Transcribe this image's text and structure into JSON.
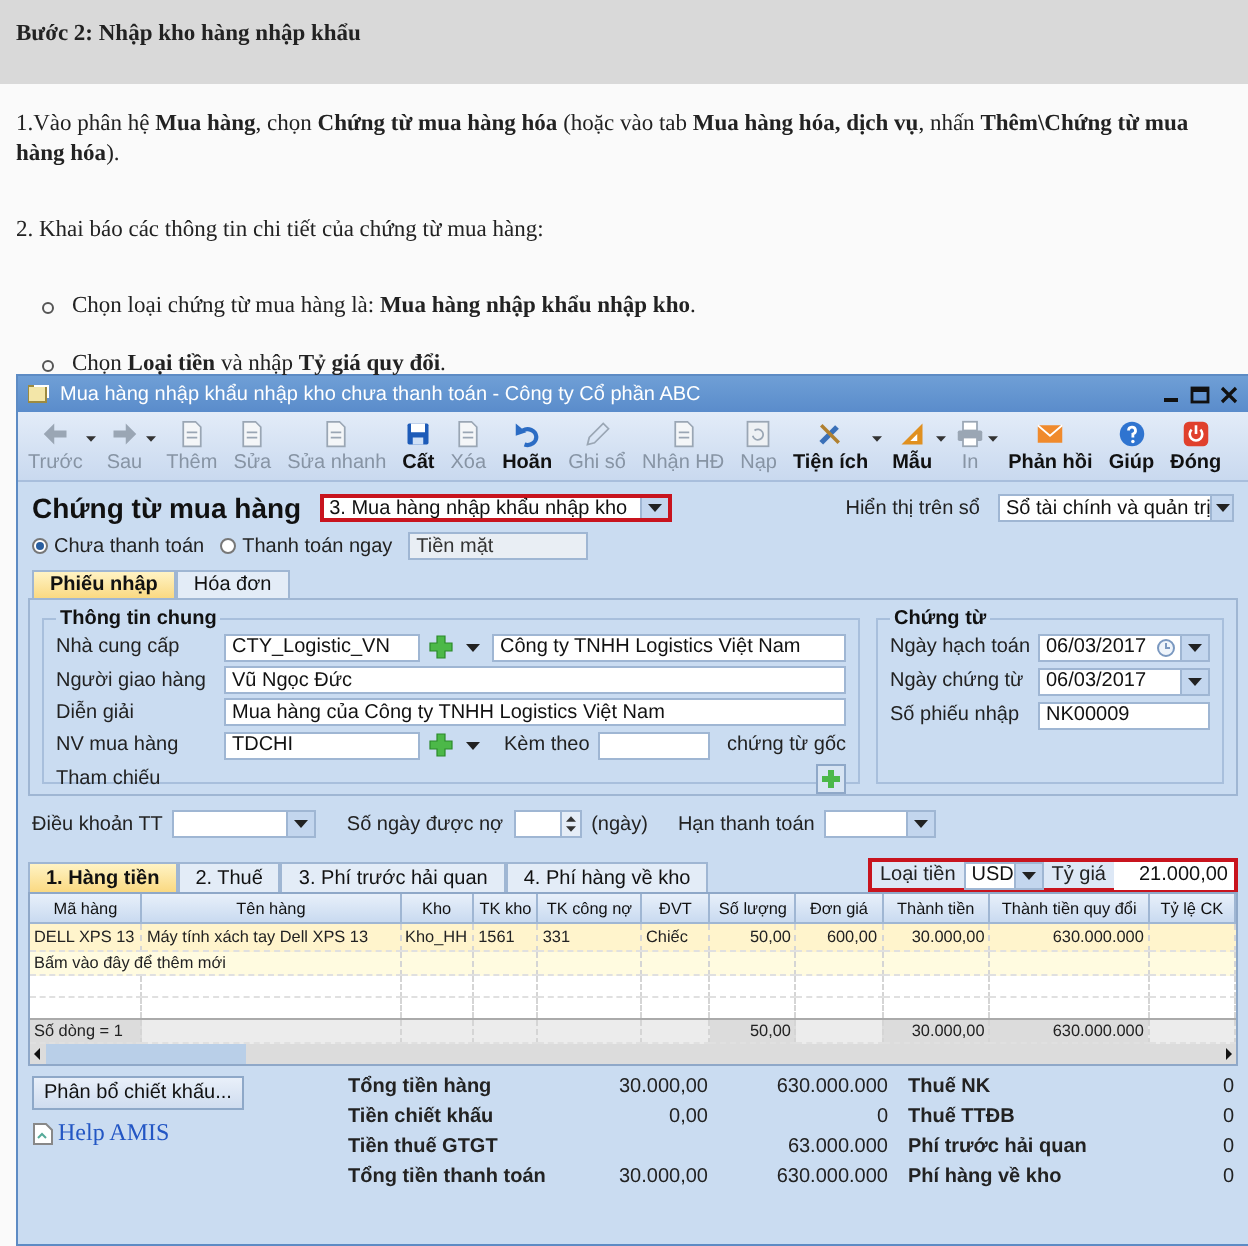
{
  "article": {
    "heading": "Bước 2: Nhập kho hàng nhập khẩu",
    "paragraphs": [
      "1.Vào phân hệ **Mua hàng**, chọn **Chứng từ mua hàng hóa** (hoặc vào tab **Mua hàng hóa, dịch vụ**, nhấn **Thêm\\Chứng từ mua hàng hóa**).",
      "2. Khai báo các thông tin chi tiết của chứng từ mua hàng:"
    ],
    "bullets": [
      "Chọn loại chứng từ mua hàng là: **Mua hàng nhập khẩu nhập kho**.",
      "Chọn **Loại tiền** và nhập **Tỷ giá quy đổi**."
    ]
  },
  "window": {
    "title": "Mua hàng nhập khẩu nhập kho chưa thanh toán - Công ty Cổ phần ABC"
  },
  "toolbar": [
    {
      "label": "Trước",
      "kind": "arrow-left",
      "disabled": true,
      "dropdown": true
    },
    {
      "label": "Sau",
      "kind": "arrow-right",
      "disabled": true,
      "dropdown": true
    },
    {
      "label": "Thêm",
      "kind": "page",
      "disabled": true,
      "dropdown": false
    },
    {
      "label": "Sửa",
      "kind": "page",
      "disabled": true,
      "dropdown": false
    },
    {
      "label": "Sửa nhanh",
      "kind": "page",
      "disabled": true,
      "dropdown": false
    },
    {
      "label": "Cất",
      "kind": "save",
      "disabled": false,
      "dropdown": false
    },
    {
      "label": "Xóa",
      "kind": "page",
      "disabled": true,
      "dropdown": false
    },
    {
      "label": "Hoãn",
      "kind": "undo",
      "disabled": false,
      "dropdown": false
    },
    {
      "label": "Ghi sổ",
      "kind": "pencil",
      "disabled": true,
      "dropdown": false
    },
    {
      "label": "Nhận HĐ",
      "kind": "page",
      "disabled": true,
      "dropdown": false
    },
    {
      "label": "Nạp",
      "kind": "refresh",
      "disabled": true,
      "dropdown": false
    },
    {
      "label": "Tiện ích",
      "kind": "tools",
      "disabled": false,
      "dropdown": true
    },
    {
      "label": "Mẫu",
      "kind": "ruler",
      "disabled": false,
      "dropdown": true
    },
    {
      "label": "In",
      "kind": "printer",
      "disabled": true,
      "dropdown": true
    },
    {
      "label": "Phản hồi",
      "kind": "mail",
      "disabled": false,
      "dropdown": false
    },
    {
      "label": "Giúp",
      "kind": "help",
      "disabled": false,
      "dropdown": false
    },
    {
      "label": "Đóng",
      "kind": "power",
      "disabled": false,
      "dropdown": false
    }
  ],
  "voucher": {
    "title": "Chứng từ mua hàng",
    "type_value": "3. Mua hàng nhập khẩu nhập kho",
    "highlighted": true,
    "ledger_label": "Hiển thị trên sổ",
    "ledger_value": "Sổ tài chính và quản trị",
    "payment_options": [
      {
        "label": "Chưa thanh toán",
        "selected": true
      },
      {
        "label": "Thanh toán ngay",
        "selected": false
      }
    ],
    "payment_method": "Tiền mặt"
  },
  "tabs": [
    {
      "label": "Phiếu nhập",
      "selected": true
    },
    {
      "label": "Hóa đơn",
      "selected": false
    }
  ],
  "general_info": {
    "title": "Thông tin chung",
    "fields": [
      {
        "label": "Nhà cung cấp",
        "kind": "lookup",
        "value": "CTY_Logistic_VN",
        "name_value": "Công ty TNHH Logistics Việt Nam"
      },
      {
        "label": "Người giao hàng",
        "kind": "text",
        "value": "Vũ Ngọc Đức"
      },
      {
        "label": "Diễn giải",
        "kind": "text",
        "value": "Mua hàng của Công ty TNHH Logistics Việt Nam"
      },
      {
        "label": "NV mua hàng",
        "kind": "lookup-attach",
        "value": "TDCHI",
        "attach_label": "Kèm theo",
        "attach_suffix": "chứng từ gốc"
      },
      {
        "label": "Tham chiếu",
        "kind": "reference"
      }
    ]
  },
  "document": {
    "title": "Chứng từ",
    "fields": [
      {
        "label": "Ngày hạch toán",
        "kind": "date-clock",
        "value": "06/03/2017"
      },
      {
        "label": "Ngày chứng từ",
        "kind": "date",
        "value": "06/03/2017"
      },
      {
        "label": "Số phiếu nhập",
        "kind": "text",
        "value": "NK00009"
      }
    ]
  },
  "terms": {
    "payment_terms_label": "Điều khoản TT",
    "credit_days_label": "Số ngày được nợ",
    "credit_days_unit": "(ngày)",
    "due_date_label": "Hạn thanh toán"
  },
  "detail_tabs": [
    {
      "label": "1. Hàng tiền",
      "selected": true
    },
    {
      "label": "2. Thuế",
      "selected": false
    },
    {
      "label": "3. Phí trước hải quan",
      "selected": false
    },
    {
      "label": "4. Phí hàng về kho",
      "selected": false
    }
  ],
  "currency": {
    "label": "Loại tiền",
    "value": "USD",
    "rate_label": "Tỷ giá",
    "rate_value": "21.000,00",
    "highlighted": true
  },
  "table": {
    "columns": [
      {
        "label": "Mã hàng"
      },
      {
        "label": "Tên hàng"
      },
      {
        "label": "Kho"
      },
      {
        "label": "TK kho"
      },
      {
        "label": "TK công nợ"
      },
      {
        "label": "ĐVT"
      },
      {
        "label": "Số lượng",
        "footer_total": "50,00"
      },
      {
        "label": "Đơn giá"
      },
      {
        "label": "Thành tiền",
        "footer_total": "30.000,00"
      },
      {
        "label": "Thành tiền quy đổi",
        "footer_total": "630.000.000"
      },
      {
        "label": "Tỷ lệ CK"
      }
    ],
    "rows": [
      [
        "DELL XPS 13",
        "Máy tính xách tay Dell XPS 13",
        "Kho_HH",
        "1561",
        "331",
        "Chiếc",
        "50,00",
        "600,00",
        "30.000,00",
        "630.000.000"
      ]
    ],
    "new_row_hint": "Bấm vào đây để thêm mới",
    "row_count": "Số dòng = 1"
  },
  "discount_button": "Phân bổ chiết khấu...",
  "help_image_alt": "Help AMIS",
  "totals": [
    {
      "label": "Tổng tiền hàng",
      "amount": "30.000,00",
      "converted": "630.000.000"
    },
    {
      "label": "Tiền chiết khấu",
      "amount": "0,00",
      "converted": "0"
    },
    {
      "label": "Tiền thuế GTGT",
      "converted": "63.000.000"
    },
    {
      "label": "Tổng tiền thanh toán",
      "amount": "30.000,00",
      "converted": "630.000.000"
    }
  ],
  "taxes": [
    {
      "label": "Thuế NK",
      "value": "0"
    },
    {
      "label": "Thuế TTĐB",
      "value": "0"
    },
    {
      "label": "Phí trước hải quan",
      "value": "0"
    },
    {
      "label": "Phí hàng về kho",
      "value": "0"
    }
  ]
}
